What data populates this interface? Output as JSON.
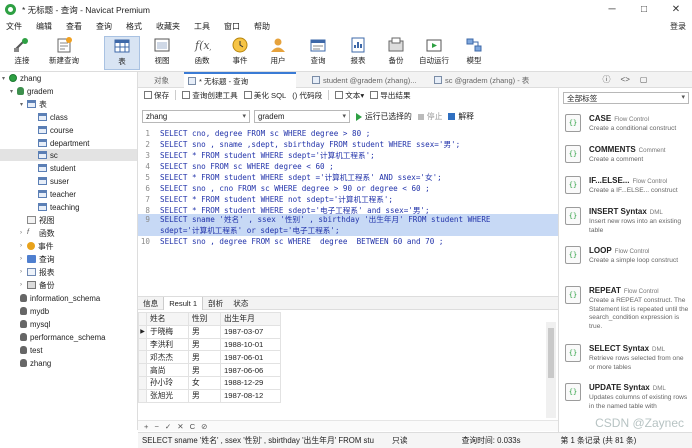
{
  "window": {
    "title": "* 无标题 - 查询 - Navicat Premium",
    "controls": [
      "─",
      "□",
      "✕"
    ]
  },
  "menu": {
    "items": [
      "文件",
      "编辑",
      "查看",
      "查询",
      "格式",
      "收藏夹",
      "工具",
      "窗口",
      "帮助"
    ],
    "login": "登录"
  },
  "toolbar": {
    "buttons": [
      {
        "label": "连接",
        "icon": "connect-icon"
      },
      {
        "label": "新建查询",
        "icon": "new-query-icon"
      },
      {
        "label": "表",
        "icon": "table-icon"
      },
      {
        "label": "视图",
        "icon": "view-icon"
      },
      {
        "label": "函数",
        "icon": "function-icon"
      },
      {
        "label": "事件",
        "icon": "event-icon"
      },
      {
        "label": "用户",
        "icon": "user-icon"
      },
      {
        "label": "查询",
        "icon": "query-icon"
      },
      {
        "label": "报表",
        "icon": "report-icon"
      },
      {
        "label": "备份",
        "icon": "backup-icon"
      },
      {
        "label": "自动运行",
        "icon": "automation-icon"
      },
      {
        "label": "模型",
        "icon": "model-icon"
      }
    ]
  },
  "tabs": [
    "对象",
    "* 无标题 - 查询",
    "student @gradem (zhang)...",
    "sc @gradem (zhang) - 表"
  ],
  "right_tabs": [
    "ⓘ",
    "<>",
    "▢"
  ],
  "sidebar": {
    "items": [
      {
        "label": "zhang",
        "icon": "connection-icon"
      },
      {
        "label": "gradem",
        "icon": "database-icon"
      },
      {
        "label": "表",
        "icon": "tables-folder-icon"
      },
      {
        "label": "class",
        "icon": "table-icon"
      },
      {
        "label": "course",
        "icon": "table-icon"
      },
      {
        "label": "department",
        "icon": "table-icon"
      },
      {
        "label": "sc",
        "icon": "table-icon"
      },
      {
        "label": "student",
        "icon": "table-icon"
      },
      {
        "label": "suser",
        "icon": "table-icon"
      },
      {
        "label": "teacher",
        "icon": "table-icon"
      },
      {
        "label": "teaching",
        "icon": "table-icon"
      },
      {
        "label": "视图",
        "icon": "views-icon"
      },
      {
        "label": "函数",
        "icon": "functions-icon"
      },
      {
        "label": "事件",
        "icon": "events-icon"
      },
      {
        "label": "查询",
        "icon": "queries-icon"
      },
      {
        "label": "报表",
        "icon": "reports-icon"
      },
      {
        "label": "备份",
        "icon": "backups-icon"
      },
      {
        "label": "information_schema",
        "icon": "database-icon"
      },
      {
        "label": "mydb",
        "icon": "database-icon"
      },
      {
        "label": "mysql",
        "icon": "database-icon"
      },
      {
        "label": "performance_schema",
        "icon": "database-icon"
      },
      {
        "label": "test",
        "icon": "database-icon"
      },
      {
        "label": "zhang",
        "icon": "database-icon"
      }
    ]
  },
  "editor_tools": [
    "保存",
    "查询创建工具",
    "美化 SQL",
    "() 代码段",
    "文本",
    "导出结果"
  ],
  "selectors": {
    "connection": "zhang",
    "database": "gradem",
    "run": "运行已选择的",
    "stop": "停止",
    "explain": "解释"
  },
  "code": [
    {
      "n": "1",
      "text": "SELECT cno, degree FROM sc WHERE degree > 80 ;"
    },
    {
      "n": "2",
      "text": "SELECT sno , sname ,sdept, sbirthday FROM student WHERE ssex='男';"
    },
    {
      "n": "3",
      "text": "SELECT * FROM student WHERE sdept='计算机工程系';"
    },
    {
      "n": "4",
      "text": "SELECT sno FROM sc WHERE degree < 60 ;"
    },
    {
      "n": "5",
      "text": "SELECT * FROM student WHERE sdept ='计算机工程系' AND ssex='女';"
    },
    {
      "n": "6",
      "text": "SELECT sno , cno FROM sc WHERE degree > 90 or degree < 60 ;"
    },
    {
      "n": "7",
      "text": "SELECT * FROM student WHERE not sdept='计算机工程系';"
    },
    {
      "n": "8",
      "text": "SELECT * FROM student WHERE sdept='电子工程系' and ssex='男';"
    },
    {
      "n": "9",
      "text": "SELECT sname '姓名' , ssex '性别' , sbirthday '出生年月' FROM student WHERE"
    },
    {
      "n": "",
      "text": "sdept='计算机工程系' or sdept='电子工程系';"
    },
    {
      "n": "10",
      "text": "SELECT sno , degree FROM sc WHERE  degree  BETWEEN 60 and 70 ;"
    }
  ],
  "result_tabs": [
    "信息",
    "Result 1",
    "剖析",
    "状态"
  ],
  "result": {
    "columns": [
      "姓名",
      "性别",
      "出生年月"
    ],
    "rows": [
      [
        "于晓梅",
        "男",
        "1987-03-07"
      ],
      [
        "李洪利",
        "男",
        "1988-10-01"
      ],
      [
        "邓杰杰",
        "男",
        "1987-06-01"
      ],
      [
        "高尚",
        "男",
        "1987-06-06"
      ],
      [
        "孙小玲",
        "女",
        "1988-12-29"
      ],
      [
        "张旭光",
        "男",
        "1987-08-12"
      ]
    ]
  },
  "grid_controls": [
    "+",
    "−",
    "✓",
    "✕",
    "C",
    "⊘"
  ],
  "status": {
    "sql": "SELECT sname '姓名' , ssex '性别' , sbirthday '出生年月' FROM stu",
    "mode": "只读",
    "time": "查询时间: 0.033s",
    "records": "第 1 条记录 (共 81 条)"
  },
  "snippets": {
    "filter": "全部标签",
    "items": [
      {
        "title": "CASE",
        "tag": "Flow Control",
        "desc": "Create a conditional construct"
      },
      {
        "title": "COMMENTS",
        "tag": "Comment",
        "desc": "Create a comment"
      },
      {
        "title": "IF...ELSE...",
        "tag": "Flow Control",
        "desc": "Create a IF...ELSE... construct"
      },
      {
        "title": "INSERT Syntax",
        "tag": "DML",
        "desc": "Insert new rows into an existing table"
      },
      {
        "title": "LOOP",
        "tag": "Flow Control",
        "desc": "Create a simple loop construct"
      },
      {
        "title": "REPEAT",
        "tag": "Flow Control",
        "desc": "Create a REPEAT construct. The Statement list is repeated until the search_condition expression is true."
      },
      {
        "title": "SELECT Syntax",
        "tag": "DML",
        "desc": "Retrieve rows selected from one or more tables"
      },
      {
        "title": "UPDATE Syntax",
        "tag": "DML",
        "desc": "Updates columns of existing rows in the named table with"
      }
    ]
  },
  "watermark": "CSDN @Zaynec"
}
